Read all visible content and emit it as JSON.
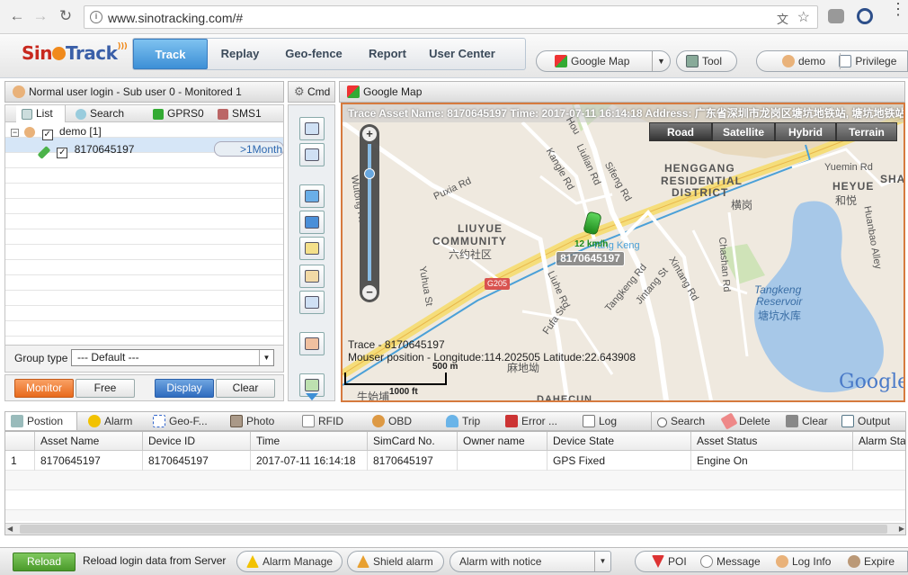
{
  "browser": {
    "url": "www.sinotracking.com/#"
  },
  "header": {
    "logo": "SinoTrack",
    "nav": [
      "Track",
      "Replay",
      "Geo-fence",
      "Report",
      "User Center"
    ],
    "map_select": "Google Map",
    "tool_label": "Tool",
    "user": "demo",
    "privilege": "Privilege"
  },
  "left": {
    "title": "Normal user login - Sub user 0 - Monitored 1",
    "tabs": [
      "List",
      "Search",
      "GPRS0",
      "SMS1"
    ],
    "group_node": "demo [1]",
    "device": "8170645197",
    "expiry_tag": ">1Month",
    "group_type_label": "Group type",
    "group_type_value": "--- Default ---",
    "buttons": [
      "Monitor",
      "Free",
      "Display",
      "Clear"
    ]
  },
  "cmd": {
    "title": "Cmd"
  },
  "map": {
    "title": "Google Map",
    "trace_bar": "Trace Asset Name: 8170645197  Time: 2017-07-11 16:14:18  Address: 广东省深圳市龙岗区塘坑地铁站, 塘坑地铁站",
    "types": [
      "Road",
      "Satellite",
      "Hybrid",
      "Terrain"
    ],
    "marker_label": "8170645197",
    "speed": "12 km/h",
    "info_trace": "Trace - 8170645197",
    "info_mouse": "Mouser position - Longitude:114.202505 Latitude:22.643908",
    "scale_m": "500 m",
    "scale_ft": "1000 ft",
    "brand": "Google",
    "labels": {
      "henggang1": "HENGGANG",
      "henggang2": "RESIDENTIAL",
      "henggang3": "DISTRICT",
      "henggang_cn": "横岗",
      "liuyue1": "LIUYUE",
      "liuyue2": "COMMUNITY",
      "liuyue_cn": "六约社区",
      "heyue": "HEYUE",
      "heyue_cn": "和悦",
      "sha": "SHA",
      "tangkeng1": "Tangkeng",
      "tangkeng2": "Reservoir",
      "tangkeng_cn": "塘坑水库",
      "dahecun": "DAHECUN",
      "malidi": "麻地坳",
      "niuxiu": "牛始埔",
      "tangkeng_st": "Tang Keng",
      "g205": "G205",
      "wutong": "Wutong Rd",
      "kangle": "Kangle Rd",
      "liulian": "Liulian Rd",
      "sifeng": "Sifeng Rd",
      "puxia": "Puxia Rd",
      "yuhua": "Yuhua St",
      "liuhe": "Liuhe Rd",
      "fufa": "Fufa St",
      "tangkengrd": "Tangkeng Rd",
      "jintang": "Jintang St",
      "xintang": "Xintang Rd",
      "chashan": "Chashan Rd",
      "yuemin": "Yuemin Rd",
      "huanbao": "Huanbao Alley",
      "hou": "Hou"
    }
  },
  "bottom": {
    "tabs": [
      "Postion",
      "Alarm",
      "Geo-F...",
      "Photo",
      "RFID",
      "OBD",
      "Trip",
      "Error ...",
      "Log"
    ],
    "actions": [
      "Search",
      "Delete",
      "Clear",
      "Output"
    ],
    "columns": [
      "Asset Name",
      "Device ID",
      "Time",
      "SimCard No.",
      "Owner name",
      "Device State",
      "Asset Status",
      "Alarm Sta"
    ],
    "rows": [
      {
        "no": "1",
        "asset": "8170645197",
        "device": "8170645197",
        "time": "2017-07-11 16:14:18",
        "sim": "8170645197",
        "owner": "",
        "state": "GPS Fixed",
        "status": "Engine On",
        "alarm": ""
      }
    ]
  },
  "footer": {
    "reload": "Reload",
    "reload_text": "Reload login data from Server",
    "alarm_manage": "Alarm Manage",
    "shield": "Shield alarm",
    "notice": "Alarm with notice",
    "poi": "POI",
    "message": "Message",
    "log_info": "Log Info",
    "expire": "Expire"
  },
  "colors": {
    "accent": "#3d8fd6",
    "monitor": "#f07a2a",
    "reload": "#5aa83a",
    "map_border": "#d67a3e"
  }
}
